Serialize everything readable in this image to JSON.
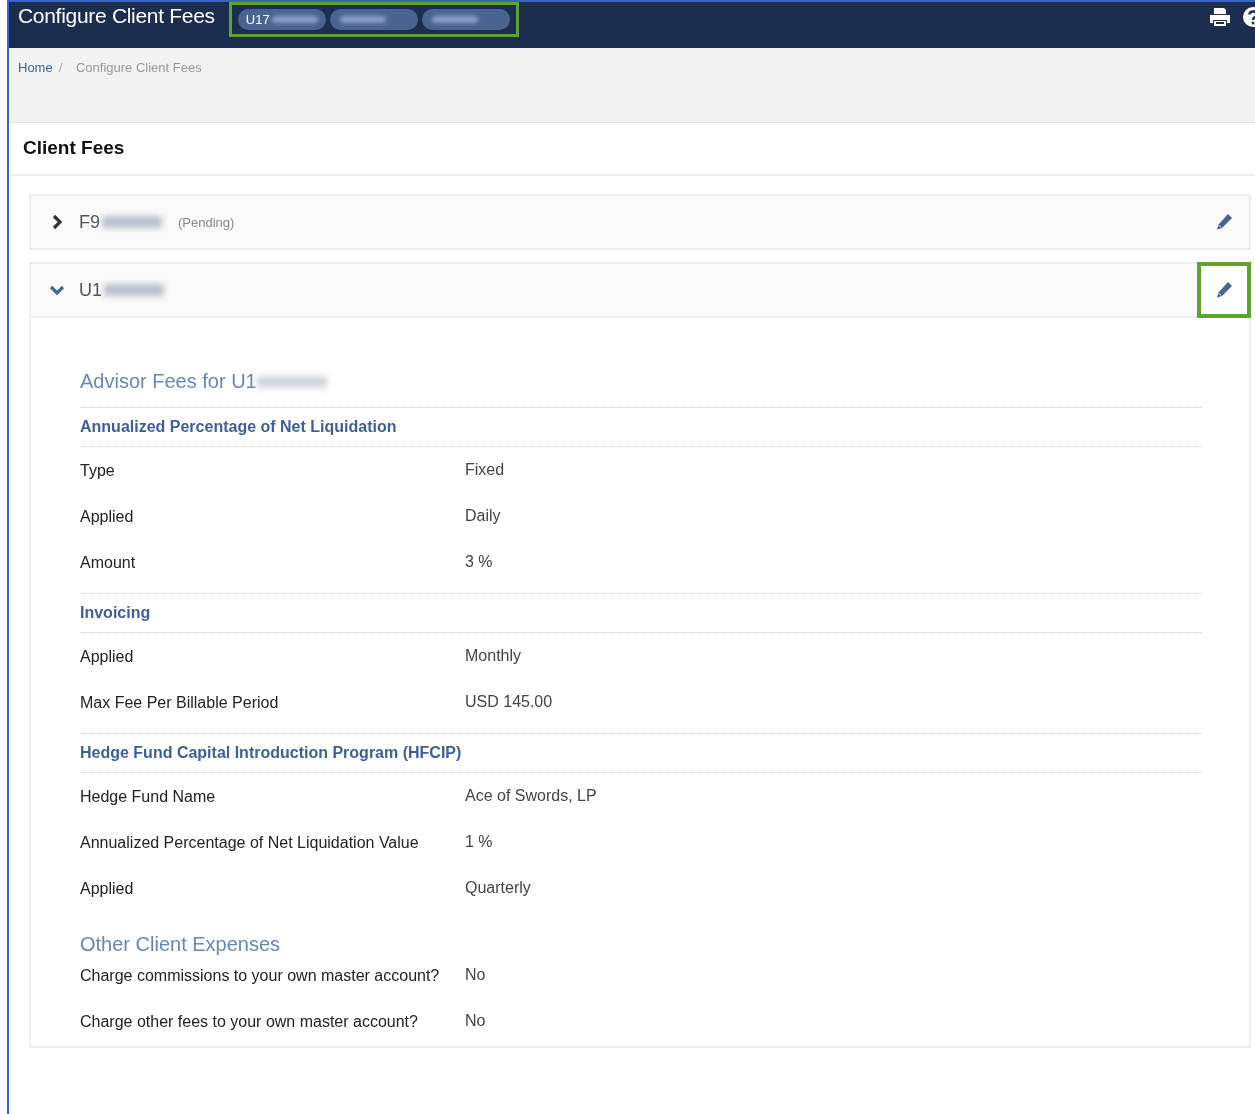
{
  "header": {
    "title": "Configure Client Fees",
    "account_chips": [
      {
        "text": "U17",
        "redacted": true
      },
      {
        "redacted": true
      },
      {
        "redacted": true
      }
    ],
    "chips_highlighted": true
  },
  "breadcrumb_separator": "/",
  "breadcrumb": [
    {
      "label": "Home",
      "link": true
    },
    {
      "label": "Configure Client Fees",
      "link": false
    }
  ],
  "page_title": "Client Fees",
  "accounts": [
    {
      "id": "F9",
      "redacted": true,
      "status": "(Pending)",
      "expanded": false,
      "edit_highlighted": false
    },
    {
      "id": "U1",
      "redacted": true,
      "expanded": true,
      "edit_highlighted": true,
      "details": [
        {
          "kind": "title",
          "text": "Advisor Fees for U1",
          "redacted": true
        },
        {
          "kind": "heading",
          "text": "Annualized Percentage of Net Liquidation"
        },
        {
          "kind": "row",
          "label": "Type",
          "value": "Fixed"
        },
        {
          "kind": "row",
          "label": "Applied",
          "value": "Daily"
        },
        {
          "kind": "row",
          "label": "Amount",
          "value": "3 %"
        },
        {
          "kind": "heading",
          "text": "Invoicing"
        },
        {
          "kind": "row",
          "label": "Applied",
          "value": "Monthly"
        },
        {
          "kind": "row",
          "label": "Max Fee Per Billable Period",
          "value": "USD 145.00"
        },
        {
          "kind": "heading",
          "text": "Hedge Fund Capital Introduction Program (HFCIP)"
        },
        {
          "kind": "row",
          "label": "Hedge Fund Name",
          "value": "Ace of Swords, LP"
        },
        {
          "kind": "row",
          "label": "Annualized Percentage of Net Liquidation Value",
          "value": "1 %"
        },
        {
          "kind": "row",
          "label": "Applied",
          "value": "Quarterly"
        },
        {
          "kind": "subtitle",
          "text": "Other Client Expenses"
        },
        {
          "kind": "row",
          "label": "Charge commissions to your own master account?",
          "value": "No"
        },
        {
          "kind": "row",
          "label": "Charge other fees to your own master account?",
          "value": "No"
        }
      ]
    }
  ]
}
